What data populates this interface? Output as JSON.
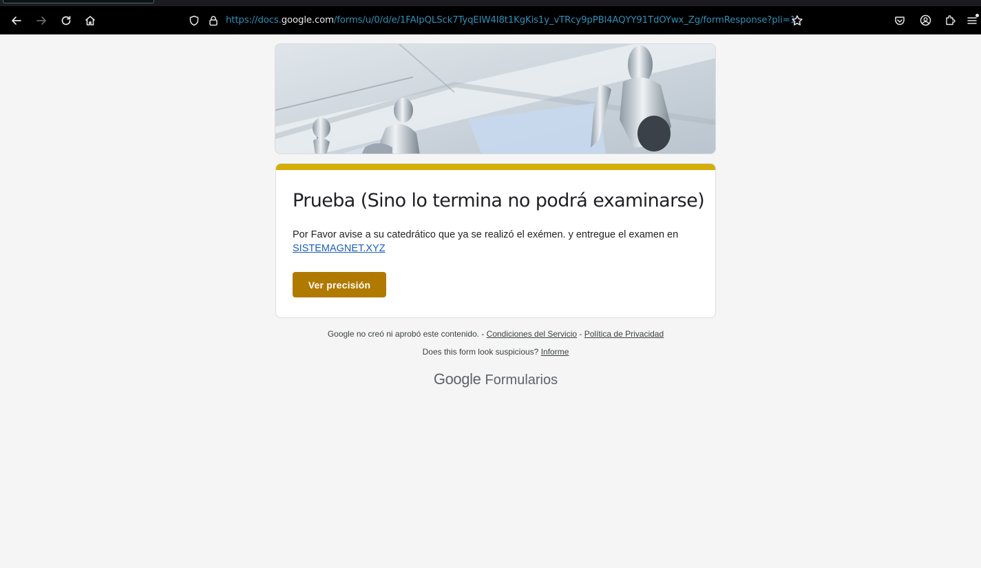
{
  "browser": {
    "url_prefix": "https://docs.",
    "url_domain": "google.com",
    "url_path": "/forms/u/0/d/e/1FAIpQLSck7TyqEIW4I8t1KgKis1y_vTRcy9pPBl4AQYY91TdOYwx_Zg/formResponse?pli=1",
    "icons": [
      "back-arrow-icon",
      "forward-arrow-icon",
      "reload-icon",
      "home-icon",
      "shield-icon",
      "lock-icon",
      "star-icon",
      "pocket-icon",
      "account-icon",
      "extensions-icon",
      "menu-icon"
    ],
    "accent_color": "#2f8fb8"
  },
  "form": {
    "title": "Prueba (Sino lo termina no podrá examinarse)",
    "message": "Por Favor avise a su catedrático que ya se realizó el exémen. y entregue el examen en",
    "link_text": "SISTEMAGNET.XYZ",
    "button_label": "Ver precisión",
    "accent_color": "#d4ad0a",
    "button_color": "#b07900"
  },
  "footer": {
    "disclaimer": "Google no creó ni aprobó este contenido. -",
    "terms_link": "Condiciones del Servicio",
    "separator": "-",
    "privacy_link": "Política de Privacidad",
    "suspicious_text": "Does this form look suspicious?",
    "report_link": "Informe",
    "brand_google": "Google",
    "brand_forms": "Formularios"
  }
}
